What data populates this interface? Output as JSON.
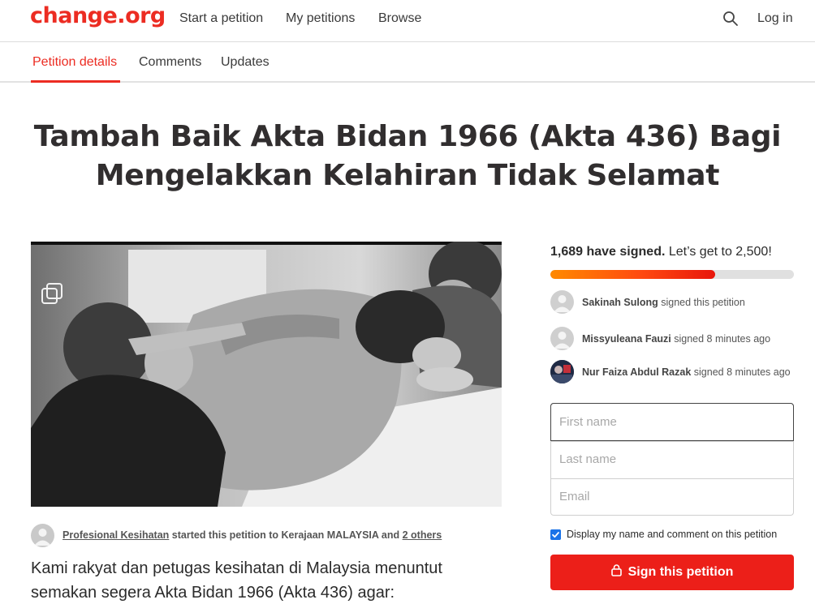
{
  "brand": {
    "logo_text": "change.org",
    "accent": "#ec2c22"
  },
  "nav": {
    "items": [
      "Start a petition",
      "My petitions",
      "Browse"
    ],
    "search_icon": "search-icon",
    "login_label": "Log in"
  },
  "tabs": [
    {
      "label": "Petition details",
      "active": true
    },
    {
      "label": "Comments",
      "active": false
    },
    {
      "label": "Updates",
      "active": false
    }
  ],
  "petition": {
    "title_line1": "Tambah Baik Akta Bidan 1966 (Akta 436) Bagi",
    "title_line2": "Mengelakkan Kelahiran Tidak Selamat",
    "starter_name": "Profesional Kesihatan",
    "starter_mid": " started this petition to Kerajaan MALAYSIA and ",
    "starter_others": "2 others",
    "story_line1": "Kami rakyat dan petugas kesihatan di Malaysia menuntut",
    "story_line2": "semakan segera Akta Bidan 1966 (Akta 436) agar:"
  },
  "signatures": {
    "count_text": "1,689 have signed.",
    "goal_text": " Let’s get to 2,500!",
    "progress_fraction": 0.6756,
    "recent": [
      {
        "name": "Sakinah Sulong",
        "action": " signed this petition"
      },
      {
        "name": "Missyuleana Fauzi",
        "action": " signed 8 minutes ago"
      },
      {
        "name": "Nur Faiza Abdul Razak",
        "action": " signed 8 minutes ago"
      }
    ]
  },
  "form": {
    "first_name_placeholder": "First name",
    "last_name_placeholder": "Last name",
    "email_placeholder": "Email",
    "display_checkbox_label": "Display my name and comment on this petition",
    "display_checked": true,
    "sign_button_label": "Sign this petition",
    "lock_icon": "lock-icon"
  }
}
